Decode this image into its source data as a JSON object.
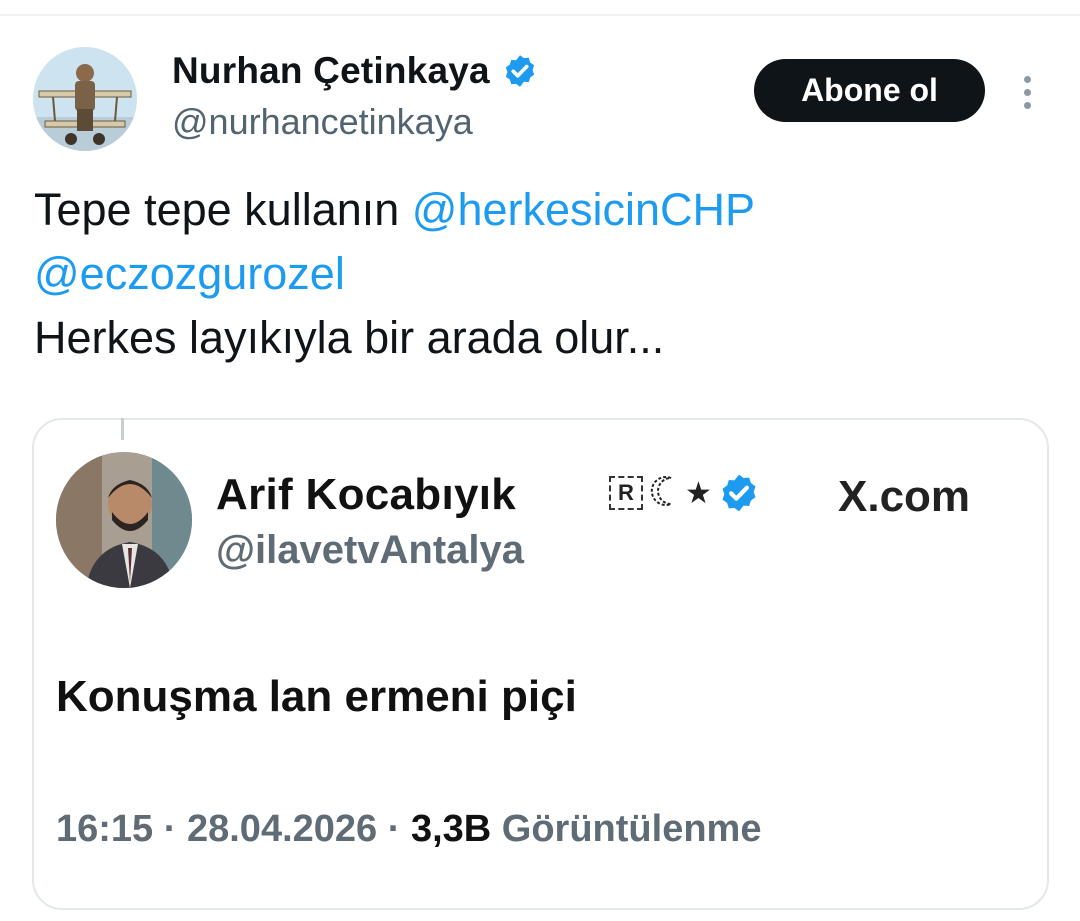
{
  "tweet": {
    "author": {
      "name": "Nurhan Çetinkaya",
      "handle": "@nurhancetinkaya",
      "verified_color": "#1d9bf0"
    },
    "follow_label": "Abone ol",
    "text": {
      "line1_prefix": "Tepe tepe kullanın ",
      "mention1": "@herkesicinCHP",
      "mention2": "@eczozgurozel",
      "line3": "Herkes layıkıyla bir arada olur..."
    },
    "colors": {
      "accent": "#1d9bf0",
      "button_bg": "#0f1419",
      "secondary_text": "#536471"
    }
  },
  "quoted_screenshot": {
    "name": "Arif Kocabıyık",
    "handle": "@ilavetvAntalya",
    "badge_letter": "R",
    "badge_star": "★",
    "site": "X.com",
    "text": "Konuşma lan ermeni piçi",
    "time": "16:15",
    "separator": " · ",
    "date": "28.04.2026",
    "views_count": "3,3B",
    "views_label": " Görüntülenme"
  }
}
